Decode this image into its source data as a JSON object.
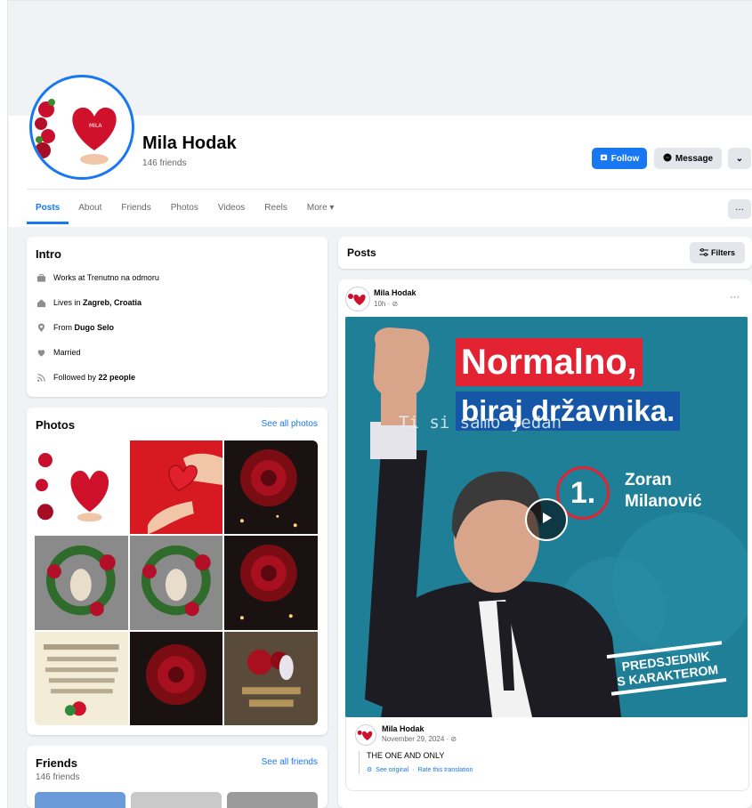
{
  "profile": {
    "name": "Mila Hodak",
    "friends_count": "146 friends",
    "follow_label": "Follow",
    "message_label": "Message"
  },
  "tabs": [
    {
      "label": "Posts",
      "active": true
    },
    {
      "label": "About"
    },
    {
      "label": "Friends"
    },
    {
      "label": "Photos"
    },
    {
      "label": "Videos"
    },
    {
      "label": "Reels"
    },
    {
      "label": "More ▾"
    }
  ],
  "intro": {
    "title": "Intro",
    "work": {
      "prefix": "Works at",
      "value": "Trenutno na odmoru"
    },
    "lives": {
      "prefix": "Lives in",
      "value": "Zagreb, Croatia"
    },
    "from": {
      "prefix": "From",
      "value": "Dugo Selo"
    },
    "relationship": "Married",
    "followed": {
      "prefix": "Followed by",
      "value": "22 people"
    }
  },
  "photos": {
    "title": "Photos",
    "see_all": "See all photos"
  },
  "friends": {
    "title": "Friends",
    "count": "146 friends",
    "see_all": "See all friends"
  },
  "posts_header": {
    "title": "Posts",
    "filters_label": "Filters"
  },
  "post": {
    "author": "Mila Hodak",
    "time": "10h",
    "media": {
      "headline1": "Normalno,",
      "headline2": "biraj državnika.",
      "overlay_text": "Ti si samo jedan",
      "number": "1.",
      "candidate_first": "Zoran",
      "candidate_last": "Milanović",
      "slogan_line1": "PREDSJEDNIK",
      "slogan_line2": "S KARAKTEROM"
    },
    "shared": {
      "author": "Mila Hodak",
      "date": "November 29, 2024",
      "caption": "THE ONE AND ONLY",
      "see_original": "See original",
      "rate": "Rate this translation"
    }
  },
  "colors": {
    "accent": "#1877f2",
    "background": "#f0f2f5",
    "red": "#e32232",
    "campaign_blue": "#1556a6"
  }
}
